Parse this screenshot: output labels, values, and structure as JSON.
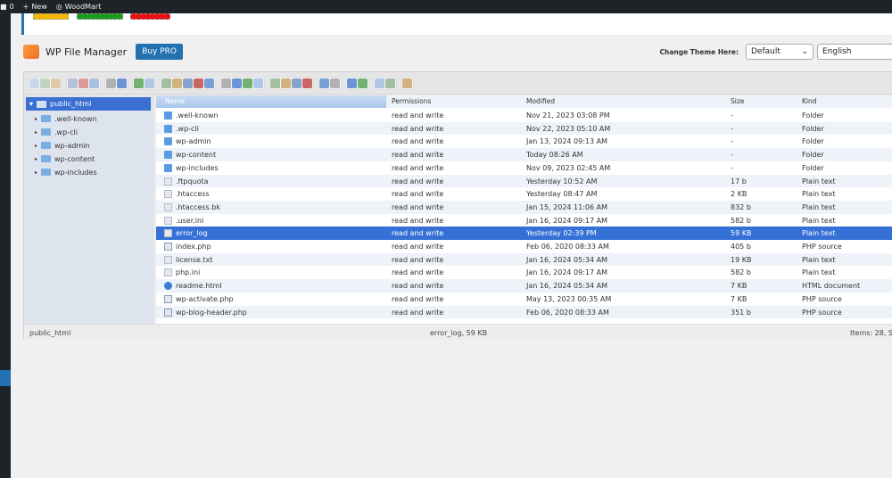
{
  "adminbar": {
    "comments": "0",
    "new": "New",
    "site": "WoodMart"
  },
  "header": {
    "title": "WP File Manager",
    "buy_pro": "Buy PRO",
    "theme_label": "Change Theme Here:",
    "theme_value": "Default",
    "language_value": "English"
  },
  "colors": {
    "accent": "#2271b1",
    "selected_row": "#3470d6",
    "notice_buttons": [
      "#f5b800",
      "#1a9a1a",
      "#e81010"
    ]
  },
  "tree": {
    "root": "public_html",
    "children": [
      ".well-known",
      ".wp-cli",
      "wp-admin",
      "wp-content",
      "wp-includes"
    ]
  },
  "columns": [
    "Name",
    "Permissions",
    "Modified",
    "Size",
    "Kind"
  ],
  "files": [
    {
      "name": ".well-known",
      "perm": "read and write",
      "modified": "Nov 21, 2023 03:08 PM",
      "size": "-",
      "kind": "Folder",
      "icon": "folder"
    },
    {
      "name": ".wp-cli",
      "perm": "read and write",
      "modified": "Nov 22, 2023 05:10 AM",
      "size": "-",
      "kind": "Folder",
      "icon": "folder"
    },
    {
      "name": "wp-admin",
      "perm": "read and write",
      "modified": "Jan 13, 2024 09:13 AM",
      "size": "-",
      "kind": "Folder",
      "icon": "folder"
    },
    {
      "name": "wp-content",
      "perm": "read and write",
      "modified": "Today 08:26 AM",
      "size": "-",
      "kind": "Folder",
      "icon": "folder"
    },
    {
      "name": "wp-includes",
      "perm": "read and write",
      "modified": "Nov 09, 2023 02:45 AM",
      "size": "-",
      "kind": "Folder",
      "icon": "folder"
    },
    {
      "name": ".ftpquota",
      "perm": "read and write",
      "modified": "Yesterday 10:52 AM",
      "size": "17 b",
      "kind": "Plain text",
      "icon": "text"
    },
    {
      "name": ".htaccess",
      "perm": "read and write",
      "modified": "Yesterday 08:47 AM",
      "size": "2 KB",
      "kind": "Plain text",
      "icon": "text"
    },
    {
      "name": ".htaccess.bk",
      "perm": "read and write",
      "modified": "Jan 15, 2024 11:06 AM",
      "size": "832 b",
      "kind": "Plain text",
      "icon": "text"
    },
    {
      "name": ".user.ini",
      "perm": "read and write",
      "modified": "Jan 16, 2024 09:17 AM",
      "size": "582 b",
      "kind": "Plain text",
      "icon": "text"
    },
    {
      "name": "error_log",
      "perm": "read and write",
      "modified": "Yesterday 02:39 PM",
      "size": "59 KB",
      "kind": "Plain text",
      "icon": "text",
      "selected": true
    },
    {
      "name": "index.php",
      "perm": "read and write",
      "modified": "Feb 06, 2020 08:33 AM",
      "size": "405 b",
      "kind": "PHP source",
      "icon": "php"
    },
    {
      "name": "license.txt",
      "perm": "read and write",
      "modified": "Jan 16, 2024 05:34 AM",
      "size": "19 KB",
      "kind": "Plain text",
      "icon": "text"
    },
    {
      "name": "php.ini",
      "perm": "read and write",
      "modified": "Jan 16, 2024 09:17 AM",
      "size": "582 b",
      "kind": "Plain text",
      "icon": "text"
    },
    {
      "name": "readme.html",
      "perm": "read and write",
      "modified": "Jan 16, 2024 05:34 AM",
      "size": "7 KB",
      "kind": "HTML document",
      "icon": "html"
    },
    {
      "name": "wp-activate.php",
      "perm": "read and write",
      "modified": "May 13, 2023 00:35 AM",
      "size": "7 KB",
      "kind": "PHP source",
      "icon": "php"
    },
    {
      "name": "wp-blog-header.php",
      "perm": "read and write",
      "modified": "Feb 06, 2020 08:33 AM",
      "size": "351 b",
      "kind": "PHP source",
      "icon": "php"
    }
  ],
  "status": {
    "path": "public_html",
    "selection": "error_log, 59 KB",
    "items": "Items: 28, S"
  }
}
